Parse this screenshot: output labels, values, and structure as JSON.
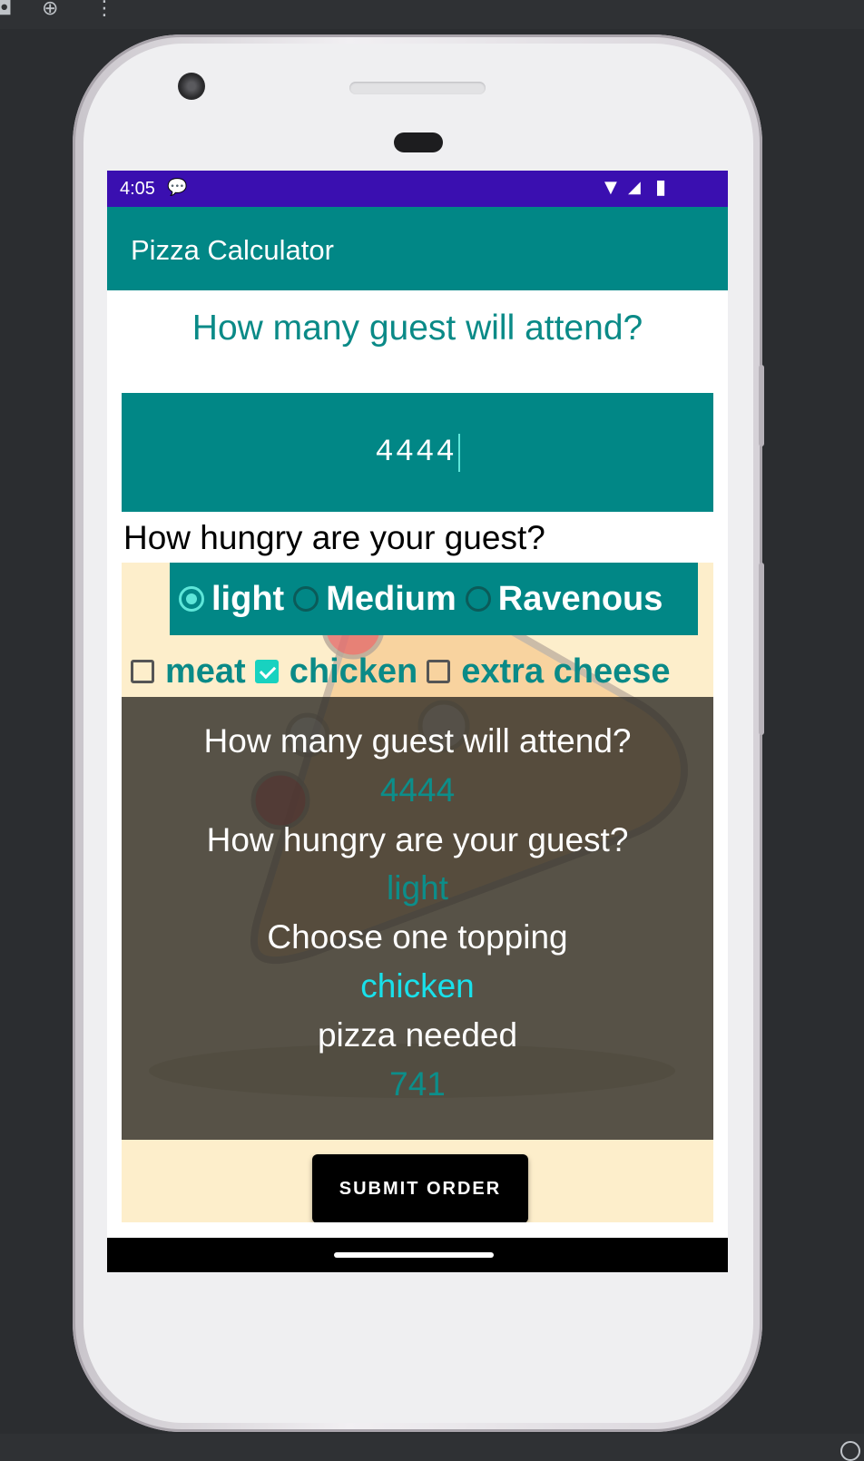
{
  "app": {
    "title": "Pizza Calculator",
    "status_time": "4:05"
  },
  "form": {
    "guests_question": "How many guest will attend?",
    "guests_value": "4444",
    "hunger_question": "How hungry are your guest?",
    "hunger_options": [
      "light",
      "Medium",
      "Ravenous"
    ],
    "hunger_selected": "light",
    "toppings": [
      "meat",
      "chicken",
      "extra cheese"
    ],
    "toppings_checked": [
      "chicken"
    ],
    "submit_label": "SUBMIT ORDER"
  },
  "summary": {
    "guests_label": "How many guest will attend?",
    "guests_value": "4444",
    "hunger_label": "How hungry are your guest?",
    "hunger_value": "light",
    "topping_label": "Choose one topping",
    "topping_value": "chicken",
    "pizza_label": "pizza needed",
    "pizza_value": "741"
  },
  "colors": {
    "status_bar": "#3a0fb0",
    "app_bar": "#018786",
    "accent": "#5ee6d9",
    "content_bg": "#fdeecb"
  },
  "icons": [
    "camera-icon",
    "add-circle-icon",
    "more-vert-icon",
    "chat-notification-icon",
    "wifi-icon",
    "signal-icon",
    "battery-icon"
  ]
}
